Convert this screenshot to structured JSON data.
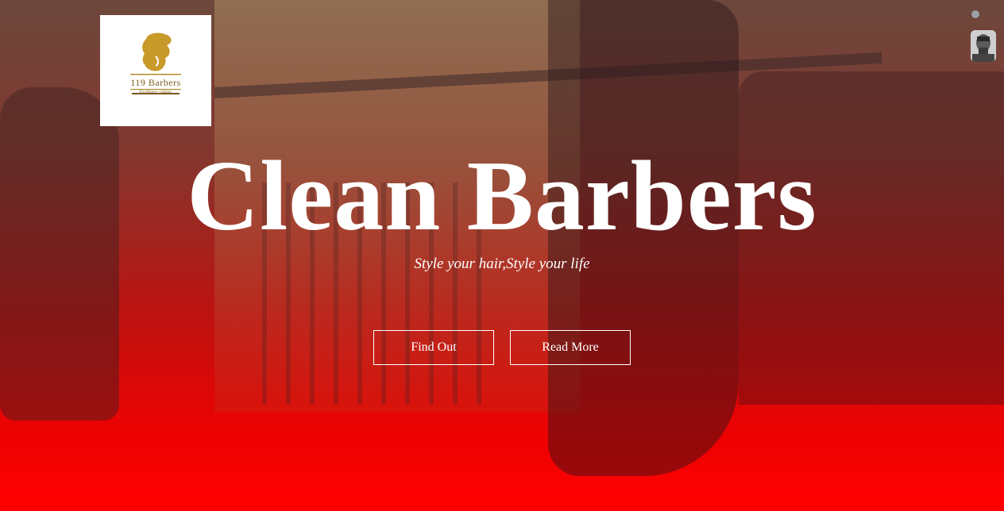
{
  "logo": {
    "name": "119 Barbers",
    "tagline": "Excellence • glamor"
  },
  "hero": {
    "title": "Clean Barbers",
    "subtitle": "Style your hair,Style your life"
  },
  "buttons": {
    "find_out": "Find Out",
    "read_more": "Read More"
  },
  "colors": {
    "overlay_bottom": "#ff0000",
    "text": "#ffffff",
    "logo_gold": "#c89a2a"
  },
  "icons": {
    "logo": "barber-head-logo-icon",
    "status": "status-dot-icon",
    "avatar": "user-avatar-icon"
  }
}
